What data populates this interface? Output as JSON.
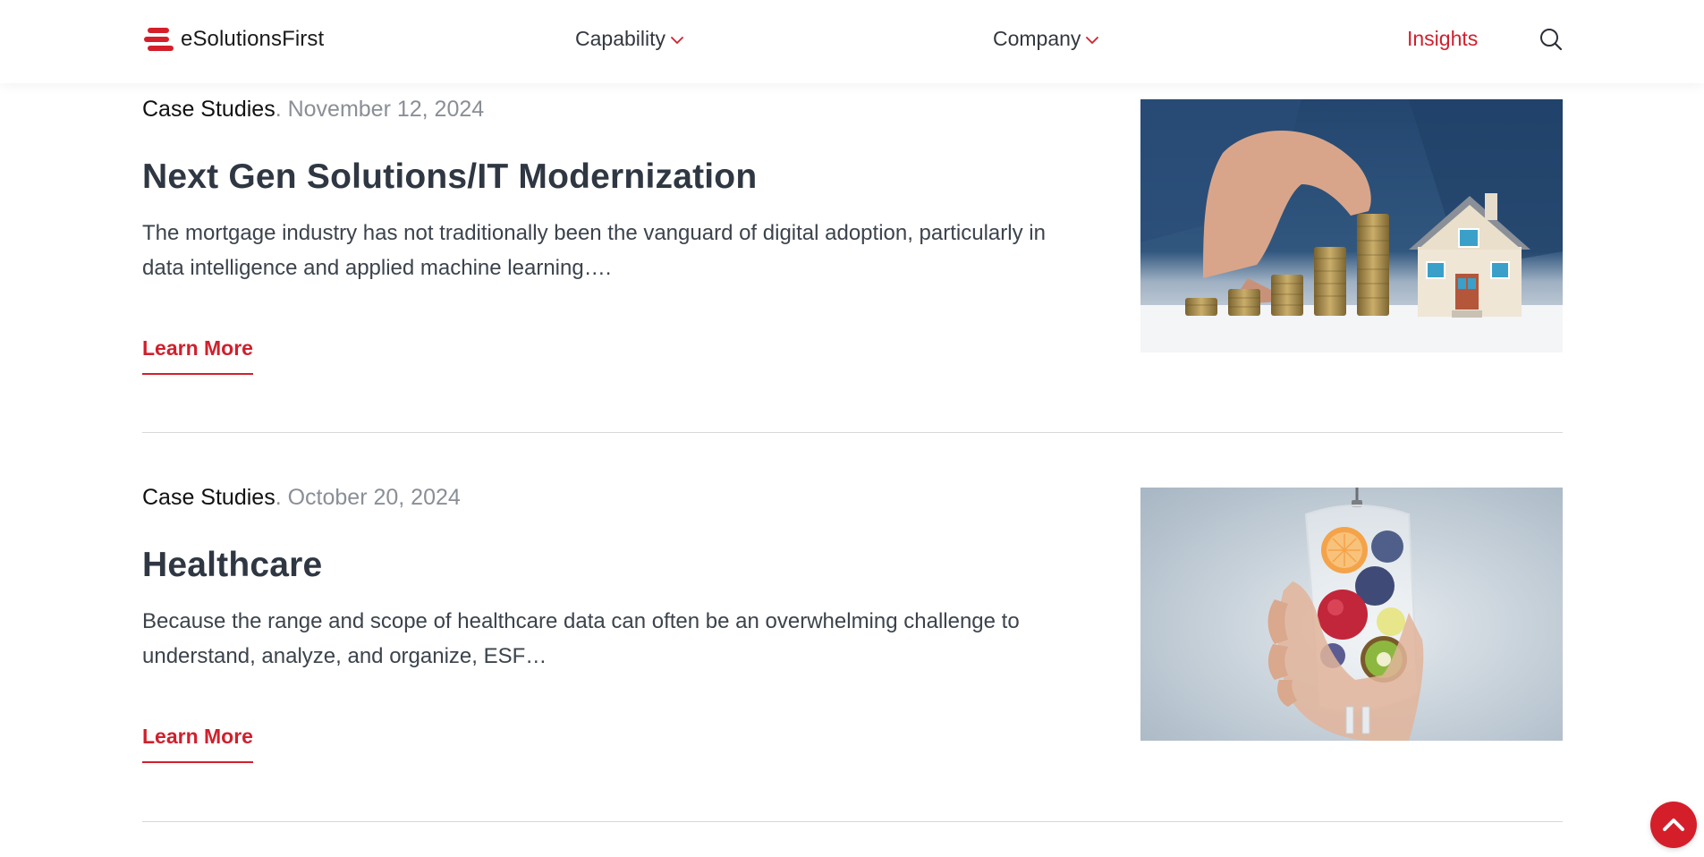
{
  "header": {
    "logo_text": "eSolutionsFirst",
    "nav": {
      "capability": "Capability",
      "company": "Company",
      "insights": "Insights"
    }
  },
  "articles": [
    {
      "category": "Case Studies",
      "date": ". November 12, 2024",
      "title": "Next Gen Solutions/IT Modernization",
      "excerpt": "The mortgage industry has not traditionally been the vanguard of digital adoption, particularly in data intelligence and applied machine learning….",
      "cta": "Learn More",
      "image_subject": "hand stacking coins next to a model house"
    },
    {
      "category": "Case Studies",
      "date": ". October 20, 2024",
      "title": "Healthcare",
      "excerpt": "Because the range and scope of healthcare data can often be an overwhelming challenge to understand, analyze, and organize, ESF…",
      "cta": "Learn More",
      "image_subject": "hand holding an IV bag filled with fruit"
    }
  ],
  "colors": {
    "accent": "#d0202d",
    "heading": "#2f3743",
    "muted": "#8a8f96"
  },
  "icons": {
    "logo": "stacked-bars-logo-icon",
    "dropdown": "chevron-down-icon",
    "search": "search-icon",
    "back_to_top": "chevron-up-icon"
  }
}
